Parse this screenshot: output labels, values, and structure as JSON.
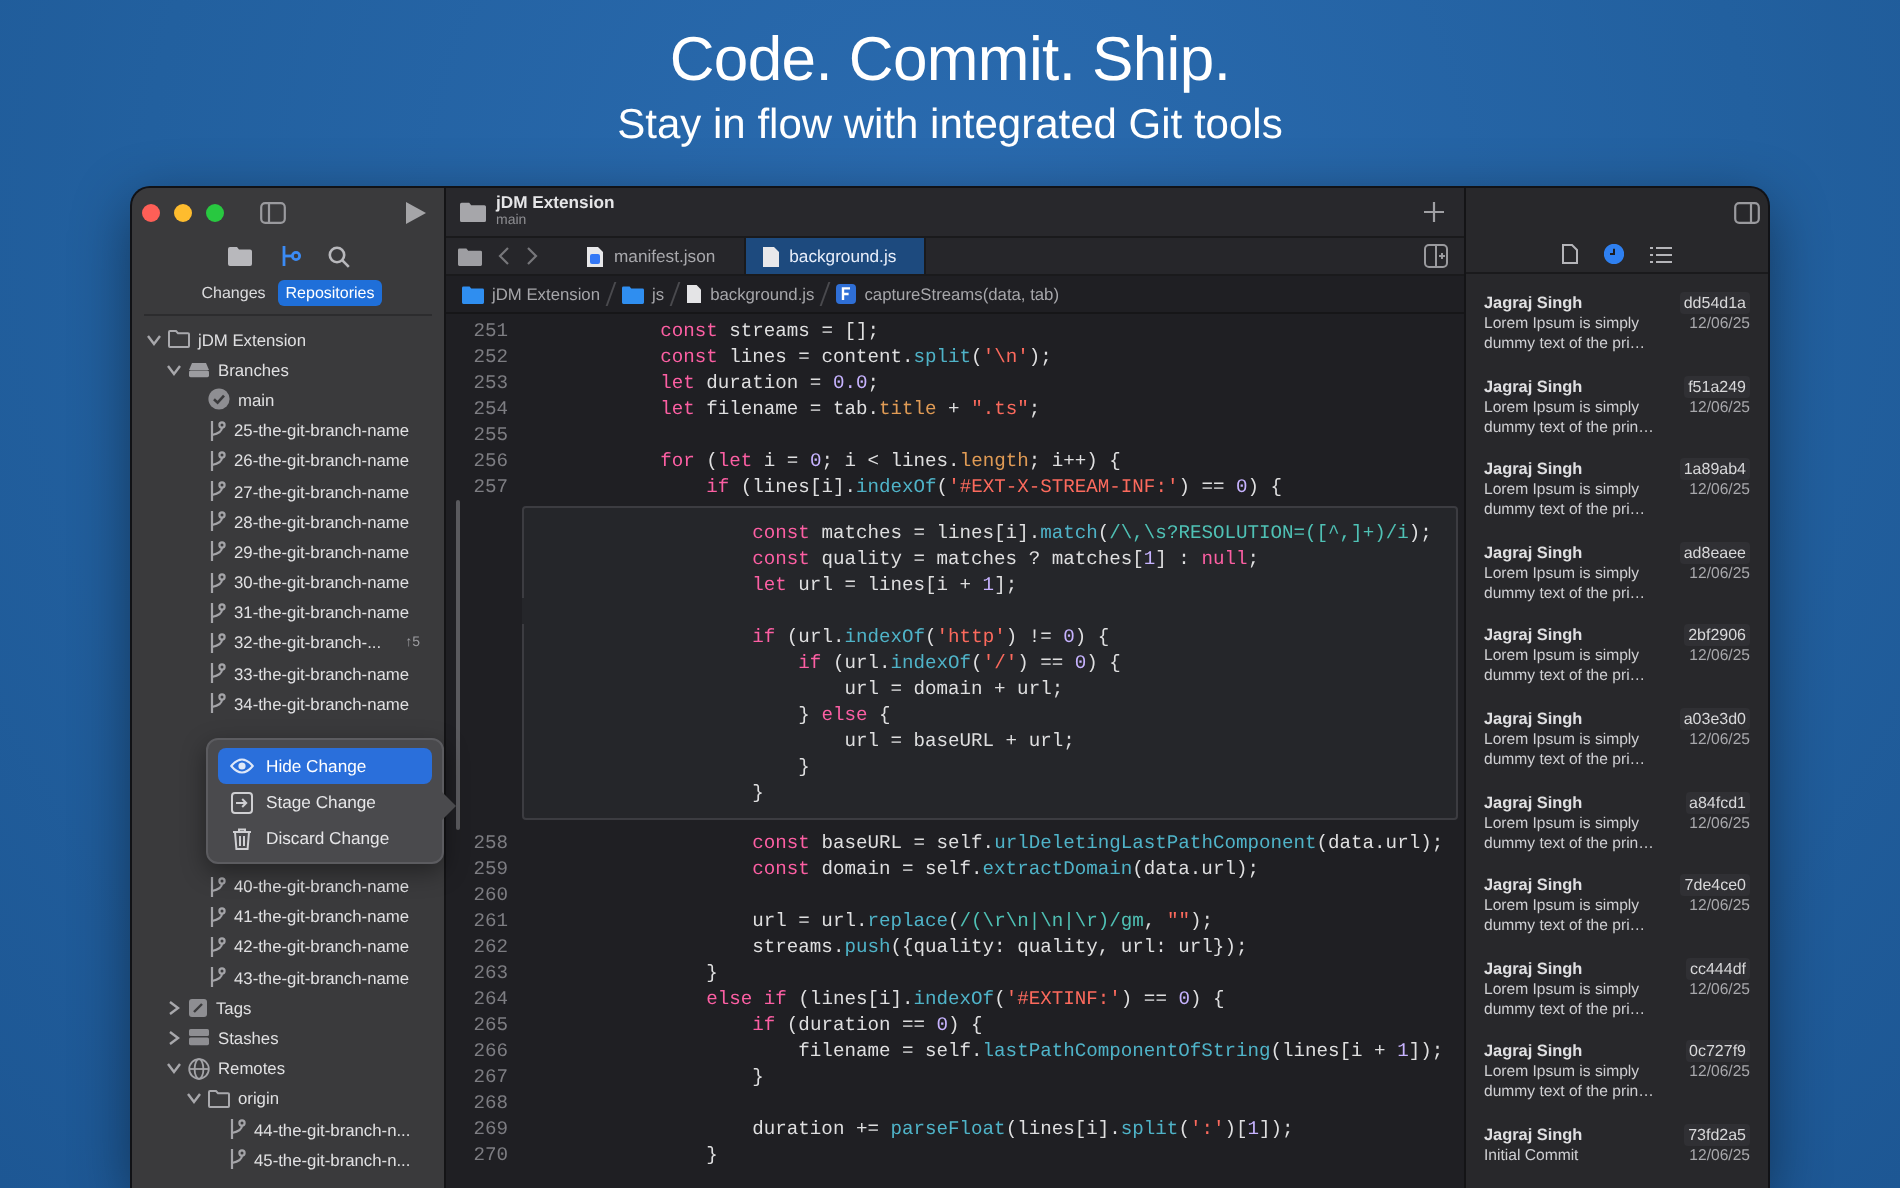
{
  "hero": {
    "title": "Code. Commit. Ship.",
    "subtitle": "Stay in flow with integrated Git tools"
  },
  "sidebar": {
    "nav_icons": [
      {
        "kind": "folder",
        "selected": false
      },
      {
        "kind": "branch",
        "selected": true
      },
      {
        "kind": "search",
        "selected": false
      }
    ],
    "segments": [
      {
        "label": "Changes",
        "selected": false
      },
      {
        "label": "Repositories",
        "selected": true
      }
    ],
    "tree": [
      {
        "kind": "repo",
        "label": "jDM Extension",
        "expanded": true,
        "children": [
          {
            "kind": "branches",
            "label": "Branches",
            "expanded": true,
            "children": [
              {
                "kind": "current",
                "label": "main"
              },
              {
                "kind": "branch",
                "label": "25-the-git-branch-name"
              },
              {
                "kind": "branch",
                "label": "26-the-git-branch-name"
              },
              {
                "kind": "branch",
                "label": "27-the-git-branch-name"
              },
              {
                "kind": "branch",
                "label": "28-the-git-branch-name"
              },
              {
                "kind": "branch",
                "label": "29-the-git-branch-name"
              },
              {
                "kind": "branch",
                "label": "30-the-git-branch-name"
              },
              {
                "kind": "branch",
                "label": "31-the-git-branch-name"
              },
              {
                "kind": "branch",
                "label": "32-the-git-branch-...",
                "badge": "↑5"
              },
              {
                "kind": "branch",
                "label": "33-the-git-branch-name"
              },
              {
                "kind": "branch",
                "label": "34-the-git-branch-name"
              },
              {
                "kind": "context-menu",
                "items": [
                  {
                    "kind": "eye",
                    "label": "Hide Change",
                    "selected": true
                  },
                  {
                    "kind": "stage",
                    "label": "Stage Change",
                    "selected": false
                  },
                  {
                    "kind": "trash",
                    "label": "Discard Change",
                    "selected": false
                  }
                ]
              },
              {
                "kind": "branch",
                "label": "40-the-git-branch-name"
              },
              {
                "kind": "branch",
                "label": "41-the-git-branch-name"
              },
              {
                "kind": "branch",
                "label": "42-the-git-branch-name"
              },
              {
                "kind": "branch",
                "label": "43-the-git-branch-name"
              }
            ]
          },
          {
            "kind": "tags",
            "label": "Tags",
            "expanded": false
          },
          {
            "kind": "stashes",
            "label": "Stashes",
            "expanded": false
          },
          {
            "kind": "remotes",
            "label": "Remotes",
            "expanded": true,
            "children": [
              {
                "kind": "folder",
                "label": "origin",
                "expanded": true,
                "children": [
                  {
                    "kind": "branch",
                    "label": "44-the-git-branch-n..."
                  },
                  {
                    "kind": "branch",
                    "label": "45-the-git-branch-n..."
                  }
                ]
              }
            ]
          }
        ]
      }
    ]
  },
  "editor": {
    "project": "jDM Extension",
    "branch": "main",
    "tabs": [
      {
        "kind": "json",
        "label": "manifest.json",
        "selected": false
      },
      {
        "kind": "js",
        "label": "background.js",
        "selected": true
      }
    ],
    "breadcrumb": [
      {
        "kind": "folder",
        "label": "jDM Extension"
      },
      {
        "kind": "folder",
        "label": "js"
      },
      {
        "kind": "file",
        "label": "background.js"
      },
      {
        "kind": "function",
        "label": "captureStreams(data, tab)"
      }
    ],
    "code": [
      {
        "kind": "lines",
        "lines": [
          {
            "number": "251",
            "tokens": [
              {
                "kind": "kw",
                "text": "            const"
              },
              {
                "kind": "p",
                "text": " streams = [];"
              }
            ]
          },
          {
            "number": "252",
            "tokens": [
              {
                "kind": "kw",
                "text": "            const"
              },
              {
                "kind": "p",
                "text": " lines = content."
              },
              {
                "kind": "fn",
                "text": "split"
              },
              {
                "kind": "p",
                "text": "("
              },
              {
                "kind": "str",
                "text": "'\\n'"
              },
              {
                "kind": "p",
                "text": ");"
              }
            ]
          },
          {
            "number": "253",
            "tokens": [
              {
                "kind": "kw",
                "text": "            let"
              },
              {
                "kind": "p",
                "text": " duration = "
              },
              {
                "kind": "num",
                "text": "0.0"
              },
              {
                "kind": "p",
                "text": ";"
              }
            ]
          },
          {
            "number": "254",
            "tokens": [
              {
                "kind": "kw",
                "text": "            let"
              },
              {
                "kind": "p",
                "text": " filename = tab."
              },
              {
                "kind": "prop",
                "text": "title"
              },
              {
                "kind": "p",
                "text": " + "
              },
              {
                "kind": "str",
                "text": "\".ts\""
              },
              {
                "kind": "p",
                "text": ";"
              }
            ]
          },
          {
            "number": "255"
          },
          {
            "number": "256",
            "tokens": [
              {
                "kind": "kw",
                "text": "            for"
              },
              {
                "kind": "p",
                "text": " ("
              },
              {
                "kind": "kw",
                "text": "let"
              },
              {
                "kind": "p",
                "text": " i = "
              },
              {
                "kind": "num",
                "text": "0"
              },
              {
                "kind": "p",
                "text": "; i < lines."
              },
              {
                "kind": "prop",
                "text": "length"
              },
              {
                "kind": "p",
                "text": "; i++) {"
              }
            ]
          },
          {
            "number": "257",
            "tokens": [
              {
                "kind": "kw",
                "text": "                if"
              },
              {
                "kind": "p",
                "text": " (lines[i]."
              },
              {
                "kind": "fn",
                "text": "indexOf"
              },
              {
                "kind": "p",
                "text": "("
              },
              {
                "kind": "str",
                "text": "'#EXT-X-STREAM-INF:'"
              },
              {
                "kind": "p",
                "text": ") == "
              },
              {
                "kind": "num",
                "text": "0"
              },
              {
                "kind": "p",
                "text": ") {"
              }
            ]
          }
        ]
      },
      {
        "kind": "change",
        "lines": [
          {
            "tokens": [
              {
                "kind": "kw",
                "text": "                    const"
              },
              {
                "kind": "p",
                "text": " matches = lines[i]."
              },
              {
                "kind": "fn",
                "text": "match"
              },
              {
                "kind": "p",
                "text": "("
              },
              {
                "kind": "re",
                "text": "/\\,\\s?RESOLUTION=([^,]+)/i"
              },
              {
                "kind": "p",
                "text": ");"
              }
            ]
          },
          {
            "tokens": [
              {
                "kind": "kw",
                "text": "                    const"
              },
              {
                "kind": "p",
                "text": " quality = matches ? matches["
              },
              {
                "kind": "num",
                "text": "1"
              },
              {
                "kind": "p",
                "text": "] : "
              },
              {
                "kind": "kw",
                "text": "null"
              },
              {
                "kind": "p",
                "text": ";"
              }
            ]
          },
          {
            "tokens": [
              {
                "kind": "kw",
                "text": "                    let"
              },
              {
                "kind": "p",
                "text": " url = lines[i + "
              },
              {
                "kind": "num",
                "text": "1"
              },
              {
                "kind": "p",
                "text": "];"
              }
            ]
          },
          {
            "blank": true
          },
          {
            "tokens": [
              {
                "kind": "kw",
                "text": "                    if"
              },
              {
                "kind": "p",
                "text": " (url."
              },
              {
                "kind": "fn",
                "text": "indexOf"
              },
              {
                "kind": "p",
                "text": "("
              },
              {
                "kind": "str",
                "text": "'http'"
              },
              {
                "kind": "p",
                "text": ") != "
              },
              {
                "kind": "num",
                "text": "0"
              },
              {
                "kind": "p",
                "text": ") {"
              }
            ]
          },
          {
            "tokens": [
              {
                "kind": "kw",
                "text": "                        if"
              },
              {
                "kind": "p",
                "text": " (url."
              },
              {
                "kind": "fn",
                "text": "indexOf"
              },
              {
                "kind": "p",
                "text": "("
              },
              {
                "kind": "str",
                "text": "'/'"
              },
              {
                "kind": "p",
                "text": ") == "
              },
              {
                "kind": "num",
                "text": "0"
              },
              {
                "kind": "p",
                "text": ") {"
              }
            ]
          },
          {
            "tokens": [
              {
                "kind": "p",
                "text": "                            url = domain + url;"
              }
            ]
          },
          {
            "tokens": [
              {
                "kind": "p",
                "text": "                        } "
              },
              {
                "kind": "kw",
                "text": "else"
              },
              {
                "kind": "p",
                "text": " {"
              }
            ]
          },
          {
            "tokens": [
              {
                "kind": "p",
                "text": "                            url = baseURL + url;"
              }
            ]
          },
          {
            "tokens": [
              {
                "kind": "p",
                "text": "                        }"
              }
            ]
          },
          {
            "tokens": [
              {
                "kind": "p",
                "text": "                    }"
              }
            ]
          }
        ]
      },
      {
        "kind": "lines",
        "lines": [
          {
            "number": "258",
            "tokens": [
              {
                "kind": "kw",
                "text": "                    const"
              },
              {
                "kind": "p",
                "text": " baseURL = self."
              },
              {
                "kind": "fn",
                "text": "urlDeletingLastPathComponent"
              },
              {
                "kind": "p",
                "text": "(data.url);"
              }
            ]
          },
          {
            "number": "259",
            "tokens": [
              {
                "kind": "kw",
                "text": "                    const"
              },
              {
                "kind": "p",
                "text": " domain = self."
              },
              {
                "kind": "fn",
                "text": "extractDomain"
              },
              {
                "kind": "p",
                "text": "(data.url);"
              }
            ]
          },
          {
            "number": "260"
          },
          {
            "number": "261",
            "tokens": [
              {
                "kind": "p",
                "text": "                    url = url."
              },
              {
                "kind": "fn",
                "text": "replace"
              },
              {
                "kind": "p",
                "text": "("
              },
              {
                "kind": "re",
                "text": "/(\\r\\n|\\n|\\r)/gm"
              },
              {
                "kind": "p",
                "text": ", "
              },
              {
                "kind": "str",
                "text": "\"\""
              },
              {
                "kind": "p",
                "text": ");"
              }
            ]
          },
          {
            "number": "262",
            "tokens": [
              {
                "kind": "p",
                "text": "                    streams."
              },
              {
                "kind": "fn",
                "text": "push"
              },
              {
                "kind": "p",
                "text": "({quality: quality, url: url});"
              }
            ]
          },
          {
            "number": "263",
            "tokens": [
              {
                "kind": "p",
                "text": "                }"
              }
            ]
          },
          {
            "number": "264",
            "tokens": [
              {
                "kind": "kw",
                "text": "                else if"
              },
              {
                "kind": "p",
                "text": " (lines[i]."
              },
              {
                "kind": "fn",
                "text": "indexOf"
              },
              {
                "kind": "p",
                "text": "("
              },
              {
                "kind": "str",
                "text": "'#EXTINF:'"
              },
              {
                "kind": "p",
                "text": ") == "
              },
              {
                "kind": "num",
                "text": "0"
              },
              {
                "kind": "p",
                "text": ") {"
              }
            ]
          },
          {
            "number": "265",
            "tokens": [
              {
                "kind": "kw",
                "text": "                    if"
              },
              {
                "kind": "p",
                "text": " (duration == "
              },
              {
                "kind": "num",
                "text": "0"
              },
              {
                "kind": "p",
                "text": ") {"
              }
            ]
          },
          {
            "number": "266",
            "tokens": [
              {
                "kind": "p",
                "text": "                        filename = self."
              },
              {
                "kind": "fn",
                "text": "lastPathComponentOfString"
              },
              {
                "kind": "p",
                "text": "(lines[i + "
              },
              {
                "kind": "num",
                "text": "1"
              },
              {
                "kind": "p",
                "text": "]);"
              }
            ]
          },
          {
            "number": "267",
            "tokens": [
              {
                "kind": "p",
                "text": "                    }"
              }
            ]
          },
          {
            "number": "268"
          },
          {
            "number": "269",
            "tokens": [
              {
                "kind": "p",
                "text": "                    duration += "
              },
              {
                "kind": "fn",
                "text": "parseFloat"
              },
              {
                "kind": "p",
                "text": "(lines[i]."
              },
              {
                "kind": "fn",
                "text": "split"
              },
              {
                "kind": "p",
                "text": "("
              },
              {
                "kind": "str",
                "text": "':'"
              },
              {
                "kind": "p",
                "text": ")["
              },
              {
                "kind": "num",
                "text": "1"
              },
              {
                "kind": "p",
                "text": "]);"
              }
            ]
          },
          {
            "number": "270",
            "tokens": [
              {
                "kind": "p",
                "text": "                }"
              }
            ]
          }
        ]
      }
    ]
  },
  "history": {
    "view_icons": [
      {
        "kind": "file",
        "selected": false
      },
      {
        "kind": "clock",
        "selected": true
      },
      {
        "kind": "list",
        "selected": false
      }
    ],
    "commits": [
      {
        "author": "Jagraj Singh",
        "hash": "dd54d1a",
        "message": "Lorem Ipsum is simply dummy text of the pri…",
        "date": "12/06/25"
      },
      {
        "author": "Jagraj Singh",
        "hash": "f51a249",
        "message": "Lorem Ipsum is simply dummy text of the prin…",
        "date": "12/06/25"
      },
      {
        "author": "Jagraj Singh",
        "hash": "1a89ab4",
        "message": "Lorem Ipsum is simply dummy text of the pri…",
        "date": "12/06/25"
      },
      {
        "author": "Jagraj Singh",
        "hash": "ad8eaee",
        "message": "Lorem Ipsum is simply dummy text of the pri…",
        "date": "12/06/25"
      },
      {
        "author": "Jagraj Singh",
        "hash": "2bf2906",
        "message": "Lorem Ipsum is simply dummy text of the pri…",
        "date": "12/06/25"
      },
      {
        "author": "Jagraj Singh",
        "hash": "a03e3d0",
        "message": "Lorem Ipsum is simply dummy text of the pri…",
        "date": "12/06/25"
      },
      {
        "author": "Jagraj Singh",
        "hash": "a84fcd1",
        "message": "Lorem Ipsum is simply dummy text of the prin…",
        "date": "12/06/25"
      },
      {
        "author": "Jagraj Singh",
        "hash": "7de4ce0",
        "message": "Lorem Ipsum is simply dummy text of the pri…",
        "date": "12/06/25"
      },
      {
        "author": "Jagraj Singh",
        "hash": "cc444df",
        "message": "Lorem Ipsum is simply dummy text of the pri…",
        "date": "12/06/25"
      },
      {
        "author": "Jagraj Singh",
        "hash": "0c727f9",
        "message": "Lorem Ipsum is simply dummy text of the prin…",
        "date": "12/06/25"
      },
      {
        "author": "Jagraj Singh",
        "hash": "73fd2a5",
        "message": "Initial Commit",
        "date": "12/06/25"
      }
    ]
  }
}
